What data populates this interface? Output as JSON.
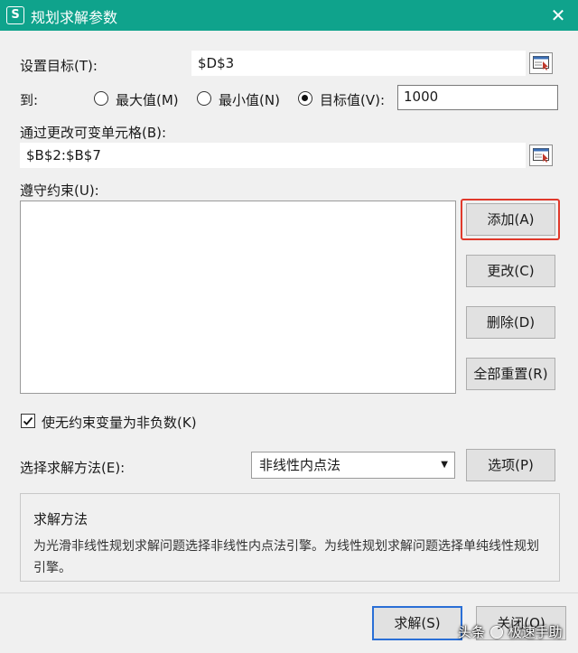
{
  "window": {
    "title": "规划求解参数",
    "app_icon_letter": "S",
    "accent_color": "#0fa38c",
    "close_glyph": "✕"
  },
  "objective": {
    "label": "设置目标(T):",
    "value": "$D$3"
  },
  "to": {
    "label": "到:",
    "options": [
      {
        "label": "最大值(M)",
        "checked": false
      },
      {
        "label": "最小值(N)",
        "checked": false
      },
      {
        "label": "目标值(V):",
        "checked": true
      }
    ],
    "target_value": "1000"
  },
  "changing_cells": {
    "label": "通过更改可变单元格(B):",
    "value": "$B$2:$B$7"
  },
  "constraints": {
    "label": "遵守约束(U):",
    "items": [],
    "buttons": {
      "add": "添加(A)",
      "change": "更改(C)",
      "delete": "删除(D)",
      "reset_all": "全部重置(R)"
    },
    "highlight_color": "#e0392b"
  },
  "nonnegative": {
    "label": "使无约束变量为非负数(K)",
    "checked": true
  },
  "method": {
    "label": "选择求解方法(E):",
    "selected": "非线性内点法",
    "options_button": "选项(P)"
  },
  "solving_method": {
    "title": "求解方法",
    "description": "为光滑非线性规划求解问题选择非线性内点法引擎。为线性规划求解问题选择单纯线性规划引擎。"
  },
  "footer": {
    "solve_button": "求解(S)",
    "close_button": "关闭(O)"
  },
  "watermark": {
    "prefix": "头条",
    "suffix": "极速手助"
  }
}
